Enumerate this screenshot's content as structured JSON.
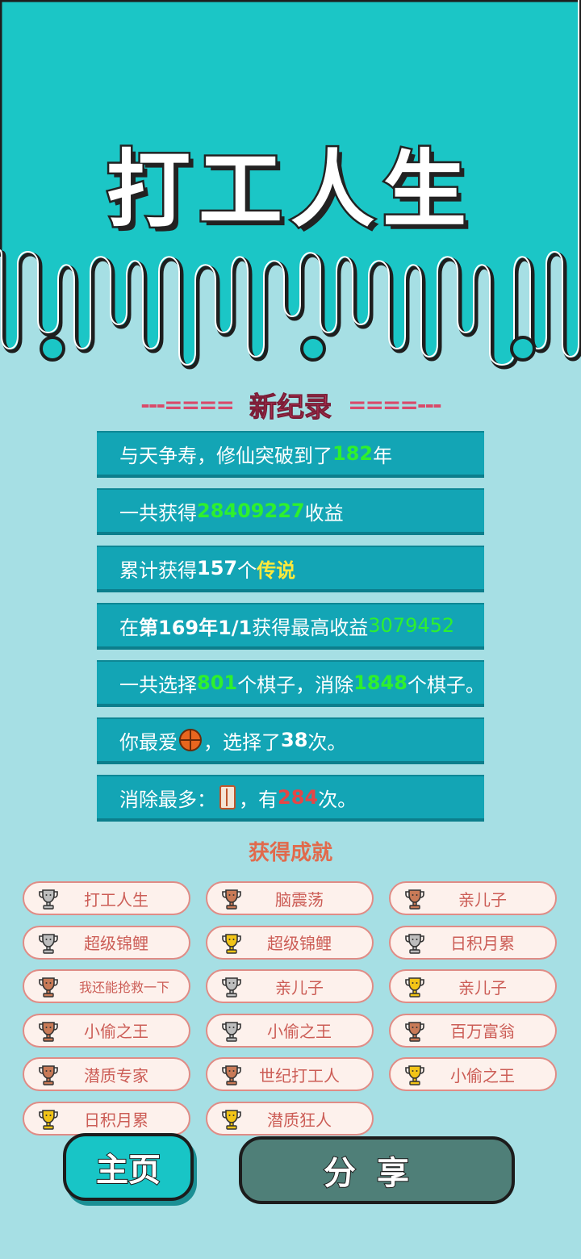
{
  "header": {
    "title": "打工人生"
  },
  "record": {
    "left_dashes": "---====",
    "title": "新纪录",
    "right_dashes": "====---"
  },
  "stats": {
    "s1": {
      "a": "与天争寿，修仙突破到了",
      "v": "182",
      "b": "年"
    },
    "s2": {
      "a": "一共获得",
      "v": "28409227",
      "b": "收益"
    },
    "s3": {
      "a": "累计获得",
      "n": "157",
      "m": "个",
      "v": "传说"
    },
    "s4": {
      "a": "在 ",
      "d": "第169年1/1",
      "m": " 获得最高收益",
      "v": "3079452"
    },
    "s5": {
      "a": "一共选择",
      "v1": "801",
      "m": "个棋子，消除",
      "v2": "1848",
      "b": "个棋子。"
    },
    "s6": {
      "a": "你最爱",
      "m": "，选择了",
      "v": "38",
      "b": "次。"
    },
    "s7": {
      "a": "消除最多：",
      "m": "，有",
      "v": "284",
      "b": "次。"
    }
  },
  "achievements": {
    "title": "获得成就",
    "items": [
      {
        "label": "打工人生",
        "tier": "silver"
      },
      {
        "label": "脑震荡",
        "tier": "bronze"
      },
      {
        "label": "亲儿子",
        "tier": "bronze"
      },
      {
        "label": "超级锦鲤",
        "tier": "silver"
      },
      {
        "label": "超级锦鲤",
        "tier": "gold"
      },
      {
        "label": "日积月累",
        "tier": "silver"
      },
      {
        "label": "我还能抢救一下",
        "tier": "bronze"
      },
      {
        "label": "亲儿子",
        "tier": "silver"
      },
      {
        "label": "亲儿子",
        "tier": "gold"
      },
      {
        "label": "小偷之王",
        "tier": "bronze"
      },
      {
        "label": "小偷之王",
        "tier": "silver"
      },
      {
        "label": "百万富翁",
        "tier": "bronze"
      },
      {
        "label": "潜质专家",
        "tier": "bronze"
      },
      {
        "label": "世纪打工人",
        "tier": "bronze"
      },
      {
        "label": "小偷之王",
        "tier": "gold"
      },
      {
        "label": "日积月累",
        "tier": "gold"
      },
      {
        "label": "潜质狂人",
        "tier": "gold"
      }
    ]
  },
  "icons": {
    "favorite": "basketball-icon",
    "most_removed": "fridge-icon",
    "achievement": "trophy-icon"
  },
  "colors": {
    "gold": "#f2c417",
    "silver": "#bdbdbd",
    "bronze": "#c97a57",
    "accent": "#18c5c6"
  },
  "buttons": {
    "home": "主页",
    "share": "分享"
  }
}
